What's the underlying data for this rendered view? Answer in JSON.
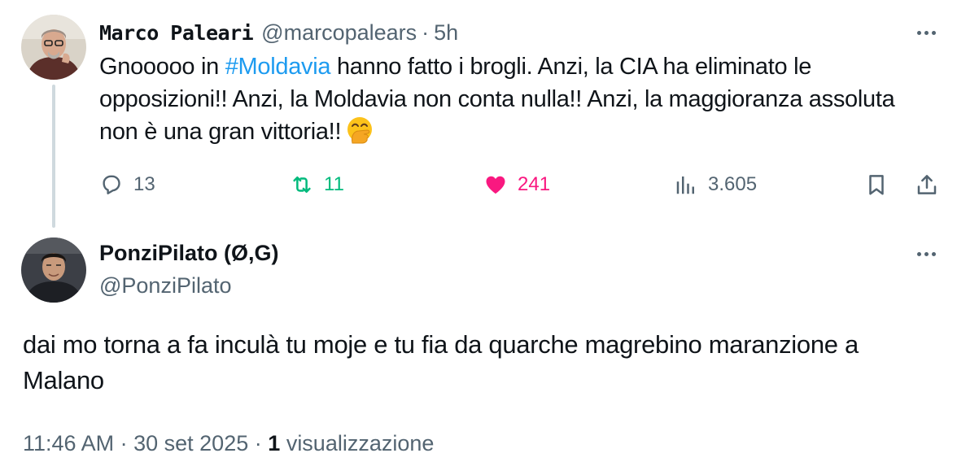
{
  "tweet1": {
    "author_name": "Marco Paleari",
    "handle": "@marcopalears",
    "separator": "·",
    "time": "5h",
    "text_before": "Gnooooo in ",
    "hashtag": "#Moldavia",
    "text_after": " hanno fatto i brogli. Anzi, la CIA ha eliminato le opposizioni!! Anzi, la Moldavia non conta nulla!! Anzi, la maggioranza assoluta non è una gran vittoria!!",
    "emoji": "face-with-hand-over-mouth",
    "replies": "13",
    "reposts": "11",
    "likes": "241",
    "views": "3.605",
    "colors": {
      "repost": "#00ba7c",
      "like": "#f91880",
      "hashtag": "#1d9bf0"
    }
  },
  "tweet2": {
    "author_name": "PonziPilato (Ø,G)",
    "handle": "@PonziPilato",
    "text": "dai mo torna a fa inculà tu moje e tu fia da quarche magrebino maranzione a Malano",
    "time": "11:46 AM",
    "date": "30 set 2025",
    "separator": "·",
    "views_count": "1",
    "views_label": "visualizzazione"
  }
}
